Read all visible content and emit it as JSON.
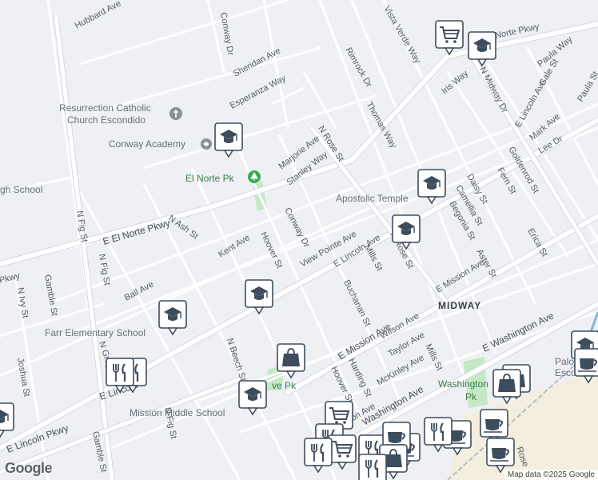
{
  "streets": {
    "hubbard_ave": "Hubbard Ave",
    "conway_dr": "Conway Dr",
    "sheridan_ave": "Sheridan Ave",
    "esperanza_way": "Esperanza Way",
    "rimrock_dr": "Rimrock Dr",
    "vista_verde_way": "Vista Verde Way",
    "norte_pkwy": "Norte Pkwy",
    "paula_way": "Paula Way",
    "gale_st": "Gale St",
    "paula_st": "Paula St",
    "iris_way": "Iris Way",
    "n_midway_dr": "N Midway Dr",
    "e_lincoln_ave_ne": "E Lincoln Ave",
    "mark_ave": "Mark Ave",
    "lee_dr": "Lee Dr",
    "thomas_way": "Thomas Way",
    "n_rose_st": "N Rose St",
    "marjorie_ave": "Marjorie Ave",
    "stanley_way": "Stanley Way",
    "goldenrod_st": "Goldenrod St",
    "fern_st": "Fern St",
    "daisy_st": "Daisy St",
    "camellia_st": "Camellia St",
    "begonia_st": "Begonia St",
    "erica_st": "Erica St",
    "conway_dr_2": "Conway Dr",
    "view_pointe_ave": "View Pointe Ave",
    "e_lincoln_ave": "E Lincoln Ave",
    "n_rose_st_2": "N Rose St",
    "mills_st": "Mills St",
    "aster_st": "Aster St",
    "e_mission_ave_ne": "E Mission Ave",
    "kent_ave": "Kent Ave",
    "hoover_st": "Hoover St",
    "n_ash_st": "N Ash St",
    "e_el_norte_pkwy": "E El Norte Pkwy",
    "n_fig_st": "N Fig St",
    "n_fig_st_2": "N Fig St",
    "n_ivy_st": "N Ivy St",
    "gamble_st": "Gamble St",
    "ball_ave": "Ball Ave",
    "pkwy": "Pkwy",
    "buchanan_st": "Buchanan St",
    "wilson_ave": "Wilson Ave",
    "taylor_ave": "Taylor Ave",
    "e_mission_ave": "E Mission Ave",
    "mills_st_2": "Mills St",
    "e_washington_ave": "E Washington Ave",
    "mckinley_ave": "McKinley Ave",
    "harding_st": "Harding St",
    "hoover_st_2": "Hoover St",
    "n_beech_st": "N Beech St",
    "n_grape_st": "N Grape St",
    "joshua_st": "Joshua St",
    "e_lincoln_ave_w": "E Lincoln",
    "e_lincoln_pkwy": "E Lincoln Pkwy",
    "n_fig_st_3": "N Fig St",
    "gamble_st_2": "Gamble St",
    "washington_ave_s": "Washington Ave",
    "erson_ave": "erson Ave",
    "rose_st_s": "Rose"
  },
  "places": {
    "resurrection_line1": "Resurrection Catholic",
    "resurrection_line2": "Church Escondido",
    "conway_academy": "Conway Academy",
    "el_norte_pk": "El Norte Pk",
    "apostolic_temple": "Apostolic Temple",
    "high_school": "gh School",
    "farr_elementary": "Farr Elementary School",
    "mission_middle": "Mission Middle School",
    "grove_pk": "ve Pk",
    "washington_pk_line1": "Washington",
    "washington_pk_line2": "Pk",
    "palomar_line1": "Palomar",
    "palomar_line2": "Escondido"
  },
  "area": {
    "midway": "MIDWAY"
  },
  "attribution": {
    "logo": "Google",
    "credit": "Map data ©2025 Google"
  },
  "colors": {
    "background": "#eef0f4",
    "road_major": "#ffffff",
    "road_outline": "#d5d9e0",
    "park": "#c5e8c5",
    "rail_commercial": "#f3eedd",
    "marker_fill": "#ffffff",
    "marker_icon": "#3d4d5c"
  },
  "markers": [
    {
      "icon": "shopping-cart-icon"
    },
    {
      "icon": "school-icon"
    },
    {
      "icon": "school-icon"
    },
    {
      "icon": "school-icon"
    },
    {
      "icon": "school-icon"
    },
    {
      "icon": "school-icon"
    },
    {
      "icon": "school-icon"
    },
    {
      "icon": "school-icon"
    },
    {
      "icon": "shopping-bag-icon"
    },
    {
      "icon": "restaurant-icon"
    },
    {
      "icon": "shopping-cart-icon"
    },
    {
      "icon": "coffee-icon"
    },
    {
      "icon": "school-icon"
    },
    {
      "icon": "coffee-icon"
    }
  ]
}
